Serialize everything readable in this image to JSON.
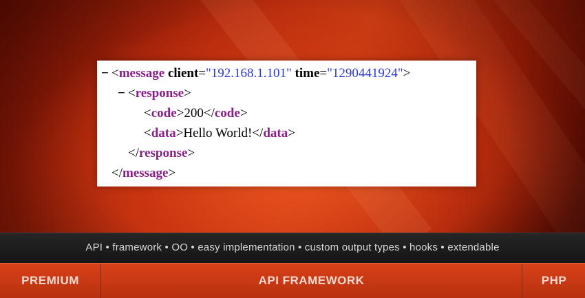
{
  "xml": {
    "l1": {
      "toggle": "−",
      "open": "<",
      "tag": "message",
      "sp1": " ",
      "attr1": "client",
      "eq1": "=",
      "val1": "\"192.168.1.101\"",
      "sp2": " ",
      "attr2": "time",
      "eq2": "=",
      "val2": "\"1290441924\"",
      "close": ">"
    },
    "l2": {
      "toggle": "−",
      "open": "<",
      "tag": "response",
      "close": ">"
    },
    "l3": {
      "open": "<",
      "tag": "code",
      "close": ">",
      "text": "200",
      "endopen": "</",
      "endtag": "code",
      "endclose": ">"
    },
    "l4": {
      "open": "<",
      "tag": "data",
      "close": ">",
      "text": "Hello World!",
      "endopen": "</",
      "endtag": "data",
      "endclose": ">"
    },
    "l5": {
      "endopen": "</",
      "endtag": "response",
      "endclose": ">"
    },
    "l6": {
      "endopen": "</",
      "endtag": "message",
      "endclose": ">"
    }
  },
  "tagline": "API • framework • OO • easy implementation • custom output types • hooks • extendable",
  "footer": {
    "left": "PREMIUM",
    "center": "API FRAMEWORK",
    "right": "PHP"
  },
  "colors": {
    "tag": "#8a1f8a",
    "attr_value": "#2a3ad6",
    "footer_bg": "#c8381a",
    "tagline_bg": "#1c1c1c"
  }
}
